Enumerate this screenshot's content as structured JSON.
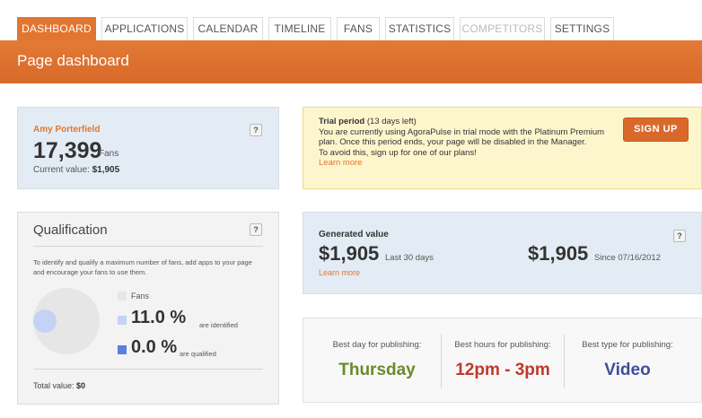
{
  "tabs": [
    {
      "label": "DASHBOARD",
      "state": "active"
    },
    {
      "label": "APPLICATIONS",
      "state": "normal"
    },
    {
      "label": "CALENDAR",
      "state": "normal"
    },
    {
      "label": "TIMELINE",
      "state": "normal"
    },
    {
      "label": "FANS",
      "state": "normal"
    },
    {
      "label": "STATISTICS",
      "state": "normal"
    },
    {
      "label": "COMPETITORS",
      "state": "disabled"
    },
    {
      "label": "SETTINGS",
      "state": "normal"
    }
  ],
  "header": {
    "title": "Page dashboard"
  },
  "profile": {
    "name": "Amy Porterfield",
    "fans_count": "17,399",
    "fans_label": "Fans",
    "current_value_label": "Current value:",
    "current_value": "$1,905",
    "help": "?"
  },
  "trial": {
    "title": "Trial period",
    "days_left": "(13 days left)",
    "line1": "You are currently using AgoraPulse in trial mode with the Platinum Premium plan. Once this period ends, your page will be disabled in the Manager.",
    "line2": "To avoid this, sign up for one of our plans!",
    "learn_more": "Learn more",
    "signup_label": "SIGN UP"
  },
  "qualification": {
    "title": "Qualification",
    "help": "?",
    "description": "To identify and qualify a maximum number of fans, add apps to your page and encourage your fans to use them.",
    "legend_fans": "Fans",
    "identified_pct": "11.0 %",
    "identified_label": "are identified",
    "qualified_pct": "0.0 %",
    "qualified_label": "are qualified",
    "total_label": "Total value:",
    "total_value": "$0",
    "colors": {
      "fans": "#e6e6e6",
      "identified": "#c4d3f5",
      "qualified": "#5b7fe0"
    }
  },
  "generated": {
    "label": "Generated value",
    "help": "?",
    "value_30": "$1,905",
    "value_30_caption": "Last 30 days",
    "value_since": "$1,905",
    "value_since_caption": "Since 07/16/2012",
    "learn_more": "Learn more"
  },
  "best": {
    "day_caption": "Best day for publishing:",
    "day_value": "Thursday",
    "hours_caption": "Best hours for publishing:",
    "hours_value": "12pm - 3pm",
    "type_caption": "Best type for publishing:",
    "type_value": "Video",
    "colors": {
      "day": "#6a8a2c",
      "hours": "#c0392b",
      "type": "#3c4f9a"
    }
  },
  "colors": {
    "accent": "#e27530",
    "panel_blue": "#e3ecf4",
    "trial_yellow": "#fdf6cd"
  }
}
